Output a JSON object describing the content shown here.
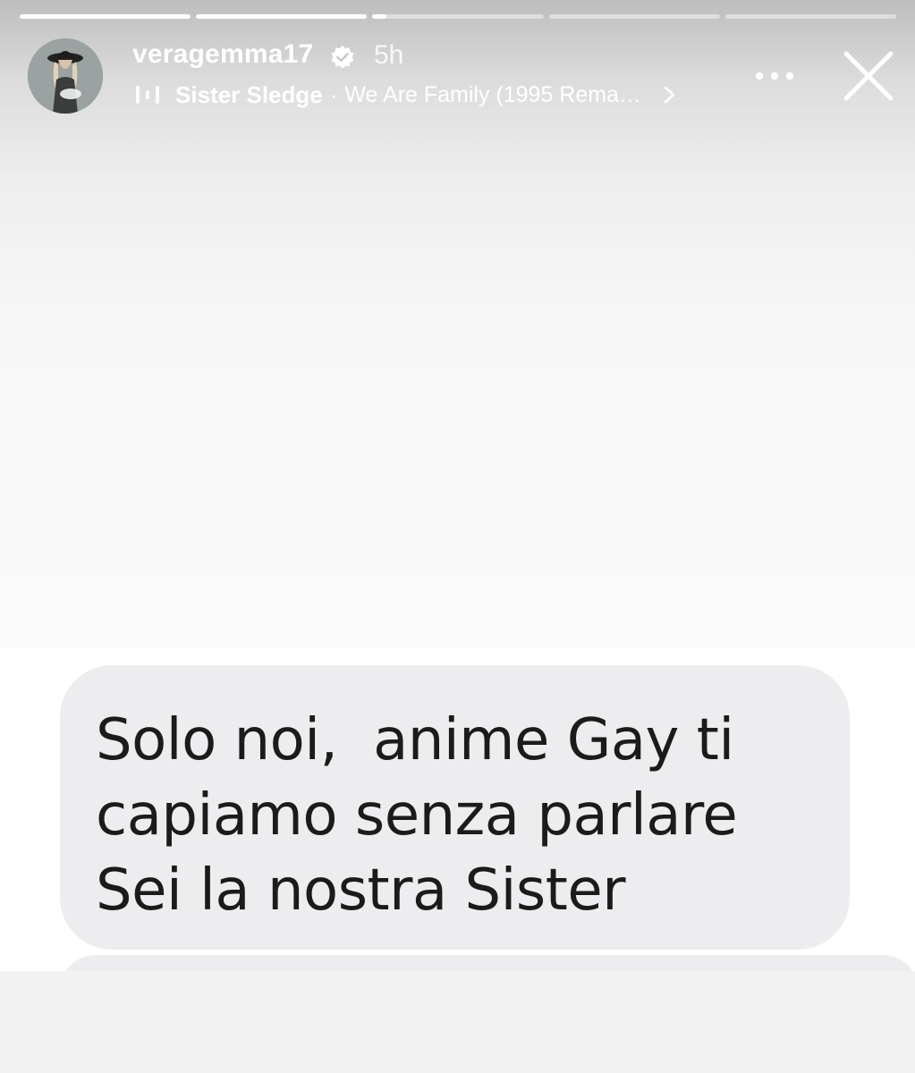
{
  "story": {
    "progress_segments": [
      {
        "state": "viewed",
        "fill": 1.0
      },
      {
        "state": "viewed",
        "fill": 1.0
      },
      {
        "state": "current",
        "fill": 0.08
      },
      {
        "state": "upcoming",
        "fill": 0.0
      },
      {
        "state": "upcoming",
        "fill": 0.0
      }
    ],
    "header": {
      "avatar_icon": "profile-avatar",
      "username": "veragemma17",
      "verified_icon": "verified-badge-icon",
      "time_ago": "5h",
      "music": {
        "icon": "music-bars-icon",
        "artist": "Sister Sledge",
        "separator": "·",
        "song": "We Are Family (1995 Rema…",
        "chevron_icon": "chevron-right-icon"
      },
      "more_icon": "more-options-icon",
      "close_icon": "close-icon"
    },
    "message": {
      "lines": [
        "Solo noi,  anime Gay ti",
        "capiamo senza parlare",
        "Sei la nostra Sister"
      ]
    },
    "colors": {
      "bubble": "#ededef",
      "text": "#1b1b1b",
      "header_text": "#ffffff"
    }
  }
}
